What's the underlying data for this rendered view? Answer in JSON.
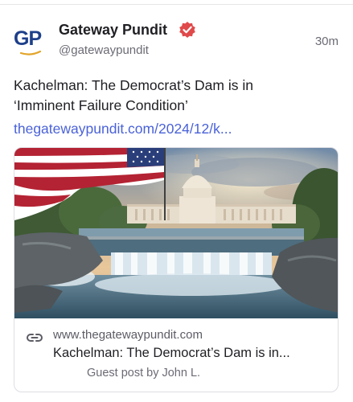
{
  "author": {
    "avatar_text": "GP",
    "display_name": "Gateway Pundit",
    "handle": "@gatewaypundit",
    "verified": true
  },
  "post": {
    "timestamp": "30m",
    "text_line1": "Kachelman: The Democrat’s Dam is in",
    "text_line2": "‘Imminent Failure Condition’",
    "link_text": "thegatewaypundit.com/2024/12/k..."
  },
  "link_card": {
    "image_description_icon": "dam-capitol-flag-image",
    "domain": "www.thegatewaypundit.com",
    "title": "Kachelman: The Democrat’s Dam is in...",
    "description": "Guest post by John L."
  },
  "colors": {
    "link": "#4a62d8",
    "avatar_blue": "#1d3f8a",
    "verified_badge": "#e04a4a"
  }
}
